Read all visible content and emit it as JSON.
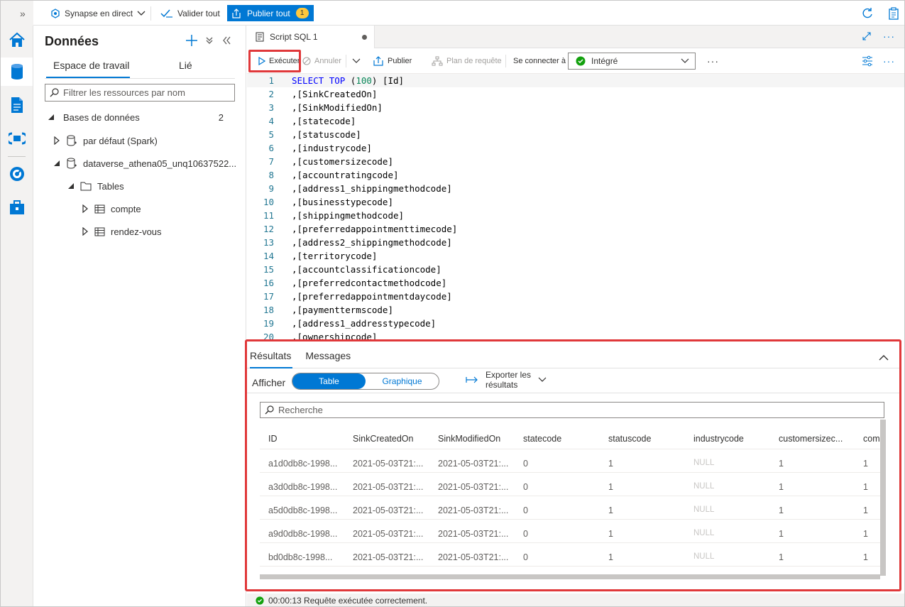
{
  "topbar": {
    "expand_glyph": "»",
    "live_label": "Synapse en direct",
    "validate_label": "Valider tout",
    "publish_label": "Publier tout",
    "publish_count": "1"
  },
  "panel": {
    "title": "Données",
    "tabs": [
      "Espace de travail",
      "Lié"
    ],
    "filter_placeholder": "Filtrer les ressources par nom",
    "tree": {
      "databases_label": "Bases de données",
      "databases_count": "2",
      "db1": "par défaut (Spark)",
      "db2": "dataverse_athena05_unq10637522...",
      "tables_label": "Tables",
      "table1": "compte",
      "table2": "rendez-vous"
    }
  },
  "editor": {
    "doc_tab": "Script SQL 1",
    "toolbar": {
      "run": "Exécuter",
      "cancel": "Annuler",
      "publish": "Publier",
      "plan": "Plan de requête",
      "connect_label": "Se connecter à",
      "connect_value": "Intégré",
      "more": "···"
    },
    "code_lines": [
      "SELECT TOP (100) [Id]",
      ",[SinkCreatedOn]",
      ",[SinkModifiedOn]",
      ",[statecode]",
      ",[statuscode]",
      ",[industrycode]",
      ",[customersizecode]",
      ",[accountratingcode]",
      ",[address1_shippingmethodcode]",
      ",[businesstypecode]",
      ",[shippingmethodcode]",
      ",[preferredappointmenttimecode]",
      ",[address2_shippingmethodcode]",
      ",[territorycode]",
      ",[accountclassificationcode]",
      ",[preferredcontactmethodcode]",
      ",[preferredappointmentdaycode]",
      ",[paymenttermscode]",
      ",[address1_addresstypecode]",
      ",[ownershipcode]"
    ]
  },
  "results": {
    "tabs": [
      "Résultats",
      "Messages"
    ],
    "show_label": "Afficher",
    "view_table": "Table",
    "view_chart": "Graphique",
    "export_label_1": "Exporter les",
    "export_label_2": "résultats",
    "search_placeholder": "Recherche",
    "columns": [
      "ID",
      "SinkCreatedOn",
      "SinkModifiedOn",
      "statecode",
      "statuscode",
      "industrycode",
      "customersizec...",
      "com"
    ],
    "rows": [
      [
        "a1d0db8c-1998...",
        "2021-05-03T21:...",
        "2021-05-03T21:...",
        "0",
        "1",
        "NULL",
        "1",
        "1"
      ],
      [
        "a3d0db8c-1998...",
        "2021-05-03T21:...",
        "2021-05-03T21:...",
        "0",
        "1",
        "NULL",
        "1",
        "1"
      ],
      [
        "a5d0db8c-1998...",
        "2021-05-03T21:...",
        "2021-05-03T21:...",
        "0",
        "1",
        "NULL",
        "1",
        "1"
      ],
      [
        "a9d0db8c-1998...",
        "2021-05-03T21:...",
        "2021-05-03T21:...",
        "0",
        "1",
        "NULL",
        "1",
        "1"
      ],
      [
        "bd0db8c-1998...",
        "2021-05-03T21:...",
        "2021-05-03T21:...",
        "0",
        "1",
        "NULL",
        "1",
        "1"
      ]
    ]
  },
  "status": {
    "text": "00:00:13 Requête exécutée correctement."
  },
  "colors": {
    "accent": "#0078d4",
    "highlight": "#e0383a",
    "success": "#13a10e",
    "badge": "#ffc83d"
  },
  "icons": [
    "home-icon",
    "database-icon",
    "document-icon",
    "pipeline-icon",
    "monitor-icon",
    "toolbox-icon",
    "refresh-icon",
    "clipboard-icon",
    "plus-icon",
    "play-icon"
  ]
}
